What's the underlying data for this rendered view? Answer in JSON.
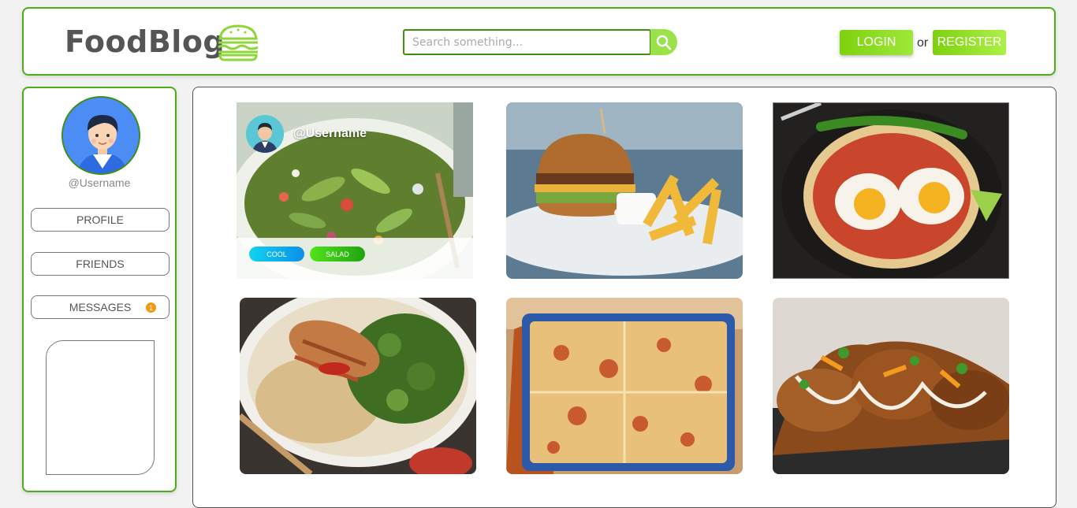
{
  "header": {
    "logo_text": "FoodBlog",
    "search_placeholder": "Search something...",
    "login_label": "LOGIN",
    "or_text": "or",
    "register_label": "REGISTER"
  },
  "sidebar": {
    "username": "@Username",
    "buttons": [
      {
        "label": "PROFILE"
      },
      {
        "label": "FRIENDS"
      },
      {
        "label": "MESSAGES",
        "badge": "1"
      }
    ]
  },
  "feed": {
    "featured": {
      "username": "@Username",
      "tags": [
        {
          "label": "COOL",
          "color": "#0fb4f5"
        },
        {
          "label": "SALAD",
          "color": "#2ec414"
        }
      ]
    },
    "cards": [
      {
        "photo": "salad-photo"
      },
      {
        "photo": "burger-fries-photo"
      },
      {
        "photo": "fried-eggs-photo"
      },
      {
        "photo": "chicken-rice-photo"
      },
      {
        "photo": "lasagna-photo"
      },
      {
        "photo": "loaded-fries-photo"
      }
    ]
  },
  "colors": {
    "accent_green": "#4caf1a",
    "button_green": "#7ed10e",
    "badge_orange": "#f29a0e"
  }
}
